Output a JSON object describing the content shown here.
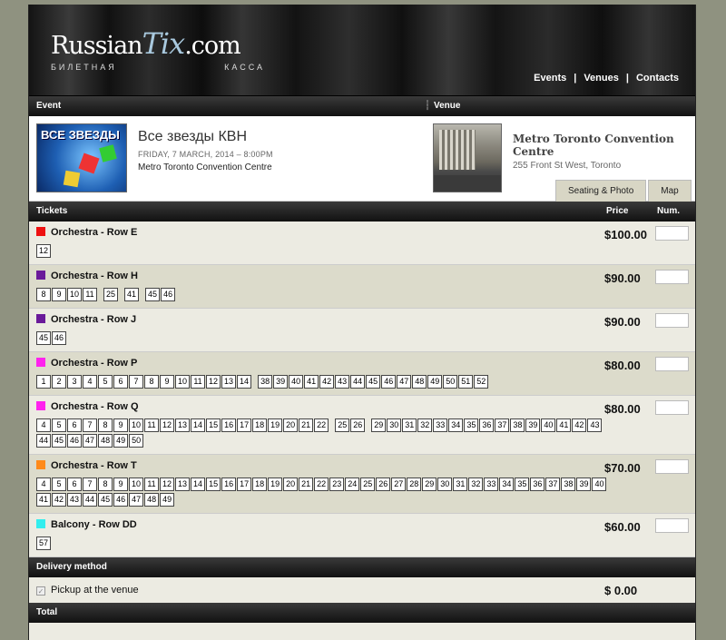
{
  "header": {
    "logo_main": "RussianTix.com",
    "logo_main_a": "Russian",
    "logo_main_b": "Tix",
    "logo_main_c": ".com",
    "logo_sub_a": "БИЛЕТНАЯ",
    "logo_sub_b": "КАССА",
    "nav": [
      "Events",
      "Venues",
      "Contacts"
    ]
  },
  "section_bar": {
    "event": "Event",
    "venue": "Venue"
  },
  "event": {
    "title": "Все звезды КВН",
    "date": "FRIDAY, 7 MARCH, 2014 – 8:00PM",
    "venue": "Metro Toronto Convention Centre",
    "thumb_text": "ВСЕ ЗВЕЗДЫ"
  },
  "venue": {
    "name": "Metro Toronto Convention Centre",
    "address": "255 Front St West, Toronto",
    "tabs": [
      "Seating & Photo",
      "Map"
    ]
  },
  "tickets_bar": {
    "tickets": "Tickets",
    "price": "Price",
    "num": "Num."
  },
  "tickets": [
    {
      "name": "Orchestra - Row E",
      "color": "#ee1111",
      "price": "$100.00",
      "seats": [
        "12"
      ]
    },
    {
      "name": "Orchestra - Row H",
      "color": "#6a1a9a",
      "price": "$90.00",
      "seats": [
        "8",
        "9",
        "10",
        "11",
        "|",
        "25",
        "|",
        "41",
        "|",
        "45",
        "46"
      ]
    },
    {
      "name": "Orchestra - Row J",
      "color": "#6a1a9a",
      "price": "$90.00",
      "seats": [
        "45",
        "46"
      ]
    },
    {
      "name": "Orchestra - Row P",
      "color": "#ff22ee",
      "price": "$80.00",
      "seats": [
        "1",
        "2",
        "3",
        "4",
        "5",
        "6",
        "7",
        "8",
        "9",
        "10",
        "11",
        "12",
        "13",
        "14",
        "|",
        "38",
        "39",
        "40",
        "41",
        "42",
        "43",
        "44",
        "45",
        "46",
        "47",
        "48",
        "49",
        "50",
        "51",
        "52"
      ]
    },
    {
      "name": "Orchestra - Row Q",
      "color": "#ff22ee",
      "price": "$80.00",
      "seats": [
        "4",
        "5",
        "6",
        "7",
        "8",
        "9",
        "10",
        "11",
        "12",
        "13",
        "14",
        "15",
        "16",
        "17",
        "18",
        "19",
        "20",
        "21",
        "22",
        "|",
        "25",
        "26",
        "|",
        "29",
        "30",
        "31",
        "32",
        "33",
        "34",
        "35",
        "36",
        "37",
        "38",
        "39",
        "40",
        "41",
        "42",
        "43",
        "44",
        "45",
        "46",
        "47",
        "48",
        "49",
        "50"
      ]
    },
    {
      "name": "Orchestra - Row T",
      "color": "#ff8a1a",
      "price": "$70.00",
      "seats": [
        "4",
        "5",
        "6",
        "7",
        "8",
        "9",
        "10",
        "11",
        "12",
        "13",
        "14",
        "15",
        "16",
        "17",
        "18",
        "19",
        "20",
        "21",
        "22",
        "23",
        "24",
        "25",
        "26",
        "27",
        "28",
        "29",
        "30",
        "31",
        "32",
        "33",
        "34",
        "35",
        "36",
        "37",
        "38",
        "39",
        "40",
        "41",
        "42",
        "43",
        "44",
        "45",
        "46",
        "47",
        "48",
        "49"
      ]
    },
    {
      "name": "Balcony - Row DD",
      "color": "#33eeee",
      "price": "$60.00",
      "seats": [
        "57"
      ]
    }
  ],
  "delivery_bar": "Delivery method",
  "delivery": {
    "option": "Pickup at the venue",
    "price": "$ 0.00"
  },
  "total_bar": "Total"
}
